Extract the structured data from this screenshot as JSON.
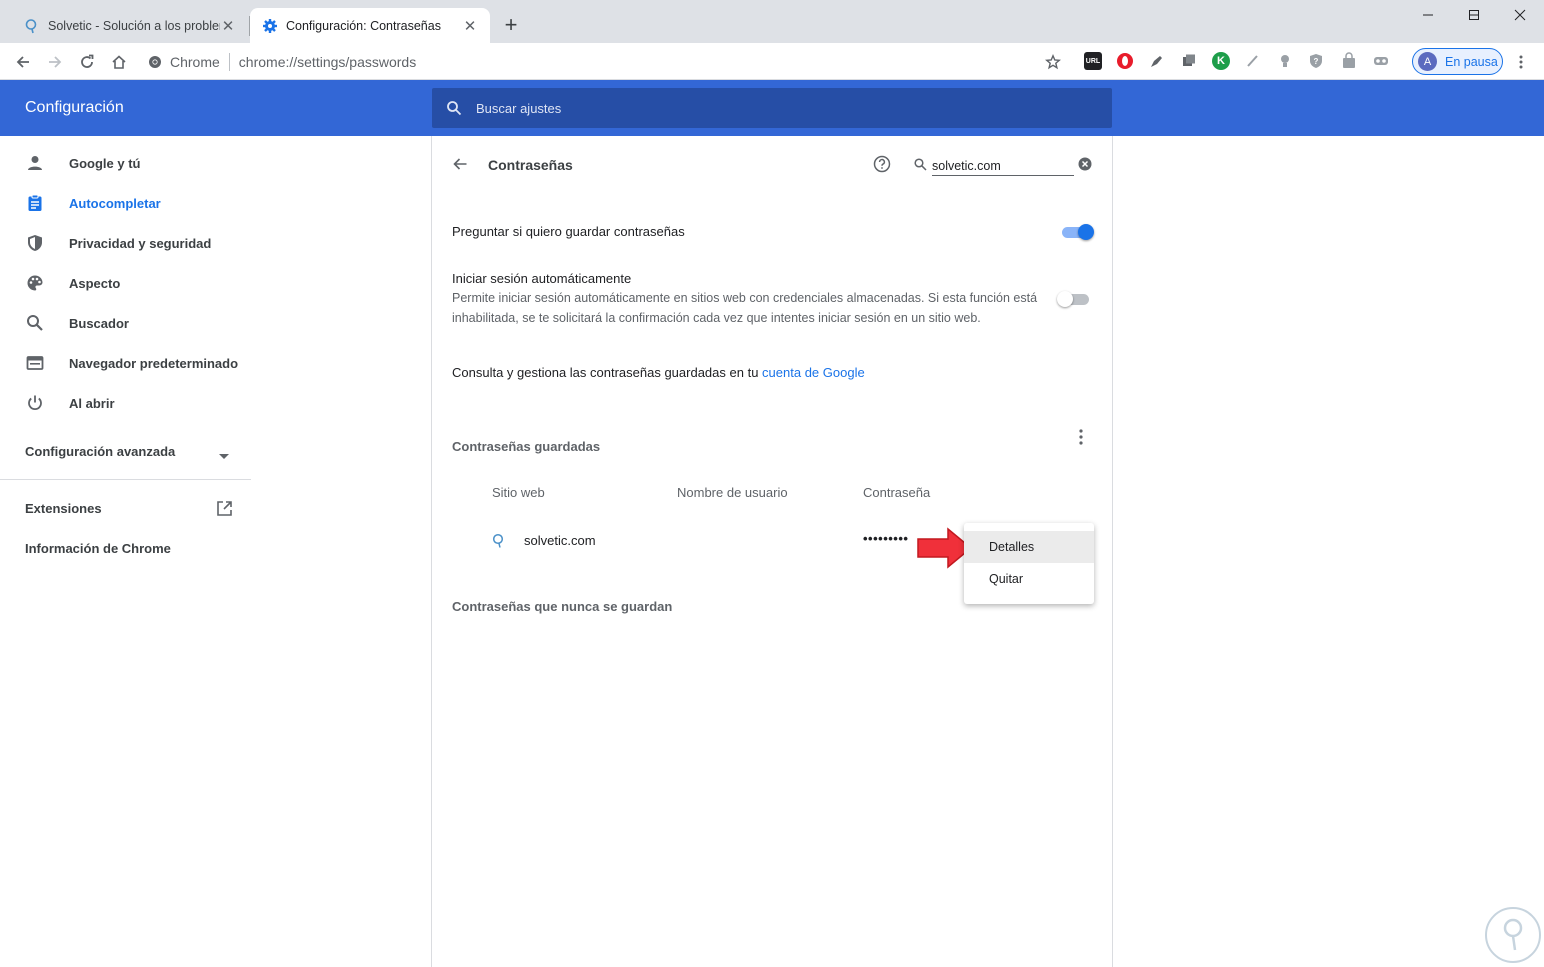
{
  "window": {
    "tabs": [
      {
        "title": "Solvetic - Solución a los problemas",
        "active": false
      },
      {
        "title": "Configuración: Contraseñas",
        "active": true
      }
    ],
    "new_tab_label": "+"
  },
  "toolbar": {
    "site_chip": "Chrome",
    "url_scheme_host": "chrome://settings",
    "url_path": "/passwords",
    "extension_url_badge": "URL",
    "extension_k_badge": "K",
    "profile_initial": "A",
    "profile_status": "En pausa"
  },
  "header": {
    "title": "Configuración",
    "search_placeholder": "Buscar ajustes"
  },
  "sidebar": {
    "items": [
      {
        "label": "Google y tú",
        "icon": "person-icon"
      },
      {
        "label": "Autocompletar",
        "icon": "clipboard-icon",
        "active": true
      },
      {
        "label": "Privacidad y seguridad",
        "icon": "shield-icon"
      },
      {
        "label": "Aspecto",
        "icon": "palette-icon"
      },
      {
        "label": "Buscador",
        "icon": "search-icon"
      },
      {
        "label": "Navegador predeterminado",
        "icon": "browser-icon"
      },
      {
        "label": "Al abrir",
        "icon": "power-icon"
      }
    ],
    "advanced_label": "Configuración avanzada",
    "extensions_label": "Extensiones",
    "about_label": "Información de Chrome"
  },
  "passwords": {
    "title": "Contraseñas",
    "search_value": "solvetic.com",
    "offer_to_save_label": "Preguntar si quiero guardar contraseñas",
    "offer_to_save_on": true,
    "auto_signin_label": "Iniciar sesión automáticamente",
    "auto_signin_desc": "Permite iniciar sesión automáticamente en sitios web con credenciales almacenadas. Si esta función está inhabilitada, se te solicitará la confirmación cada vez que intentes iniciar sesión en un sitio web.",
    "auto_signin_on": false,
    "account_text": "Consulta y gestiona las contraseñas guardadas en tu",
    "account_link": "cuenta de Google",
    "saved_header": "Contraseñas guardadas",
    "columns": {
      "site": "Sitio web",
      "user": "Nombre de usuario",
      "password": "Contraseña"
    },
    "rows": [
      {
        "site": "solvetic.com",
        "user": "",
        "password": "•••••••••"
      }
    ],
    "never_saved_header": "Contraseñas que nunca se guardan",
    "menu": {
      "details": "Detalles",
      "remove": "Quitar"
    }
  },
  "colors": {
    "header_blue": "#3367d6",
    "accent_blue": "#1a73e8",
    "arrow_red": "#f0303a"
  }
}
